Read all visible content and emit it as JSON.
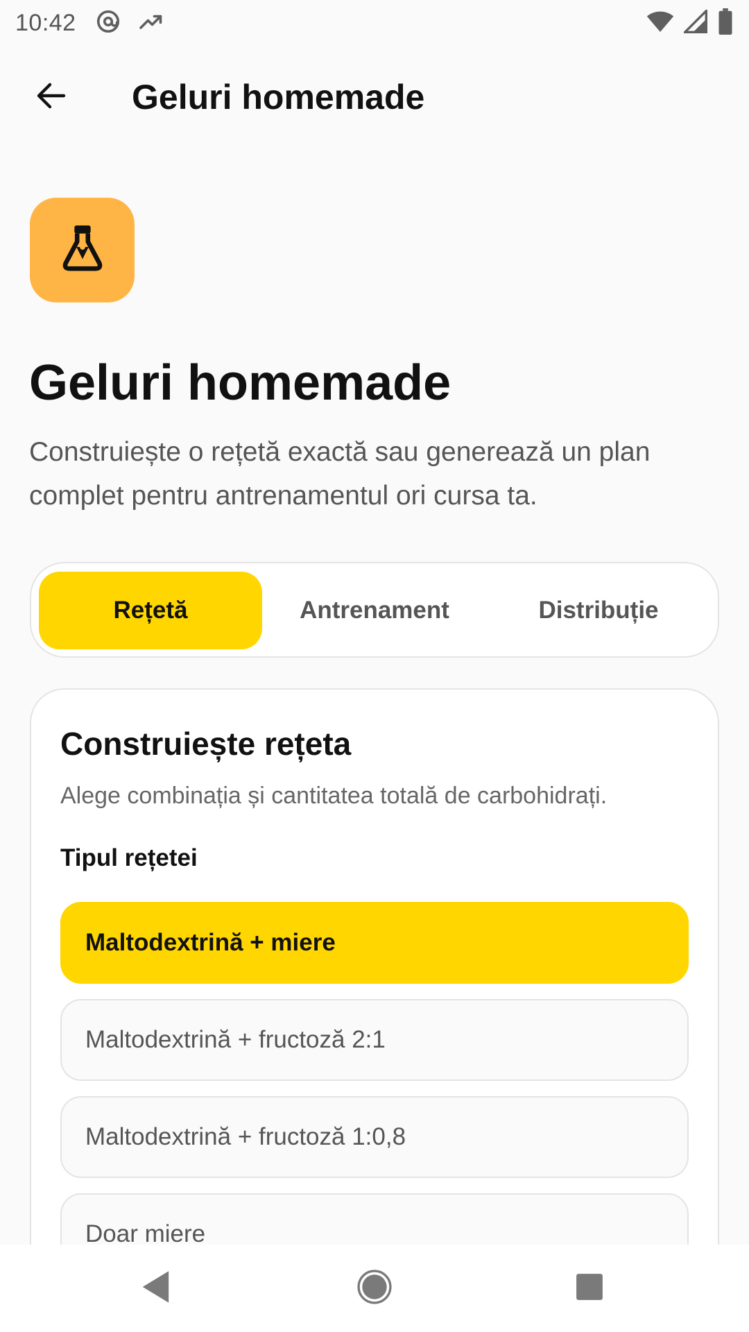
{
  "status_bar": {
    "time": "10:42",
    "left_icons": [
      "at-sign-icon",
      "trending-up-icon"
    ],
    "right_icons": [
      "wifi-icon",
      "signal-icon",
      "battery-icon"
    ]
  },
  "app_bar": {
    "back_icon": "arrow-back-icon",
    "title": "Geluri homemade"
  },
  "hero": {
    "icon": "flask-icon",
    "icon_bg": "#ffb545",
    "title": "Geluri homemade",
    "subtitle": "Construiește o rețetă exactă sau generează un plan complet pentru antrenamentul ori cursa ta."
  },
  "tabs": [
    {
      "label": "Rețetă",
      "active": true
    },
    {
      "label": "Antrenament",
      "active": false
    },
    {
      "label": "Distribuție",
      "active": false
    }
  ],
  "card": {
    "title": "Construiește rețeta",
    "subtitle": "Alege combinația și cantitatea totală de carbohidrați.",
    "section_label": "Tipul rețetei",
    "options": [
      {
        "label": "Maltodextrină + miere",
        "selected": true
      },
      {
        "label": "Maltodextrină + fructoză 2:1",
        "selected": false
      },
      {
        "label": "Maltodextrină + fructoză 1:0,8",
        "selected": false
      },
      {
        "label": "Doar miere",
        "selected": false
      }
    ]
  },
  "nav_bar": {
    "icons": [
      "nav-back-icon",
      "nav-home-icon",
      "nav-recents-icon"
    ]
  },
  "colors": {
    "accent": "#ffd600",
    "hero_icon_bg": "#ffb545",
    "background": "#fafafa",
    "text_primary": "#111111",
    "text_secondary": "#555555"
  }
}
